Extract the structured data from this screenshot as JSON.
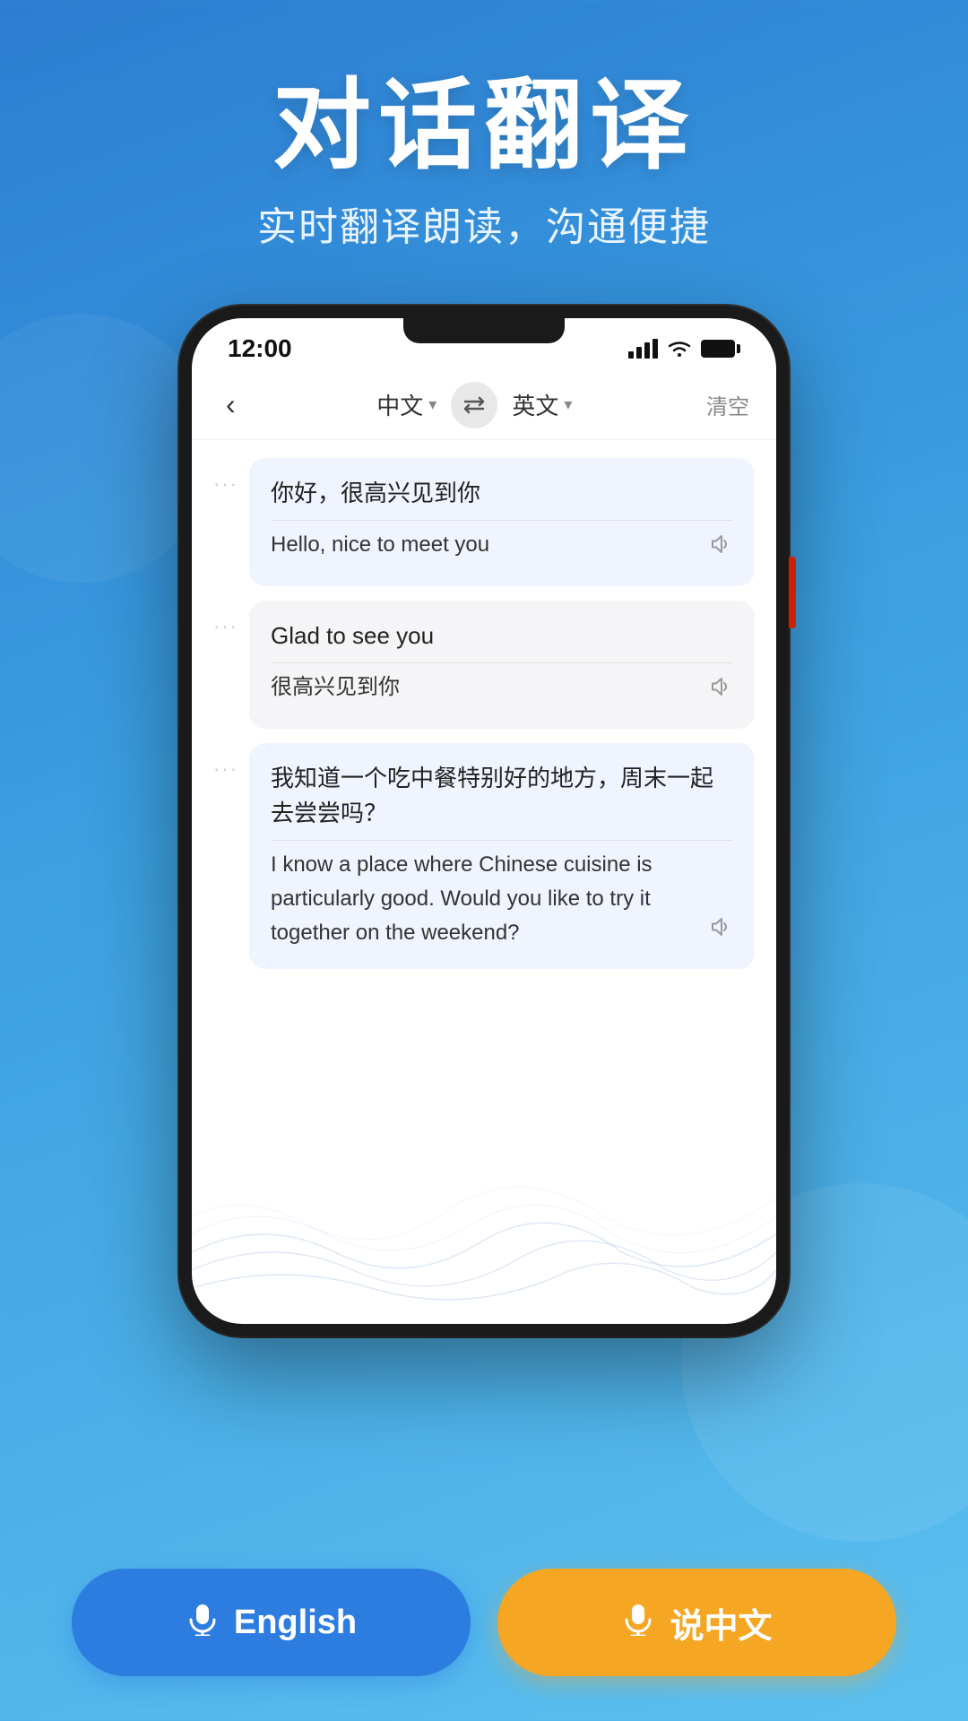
{
  "page": {
    "background_gradient_start": "#2d7dd2",
    "background_gradient_end": "#5bc0f0"
  },
  "header": {
    "main_title": "对话翻译",
    "sub_title": "实时翻译朗读，沟通便捷"
  },
  "phone": {
    "status": {
      "time": "12:00"
    },
    "nav": {
      "back_icon": "‹",
      "lang_left": "中文",
      "lang_right": "英文",
      "swap_icon": "⇄",
      "clear_label": "清空"
    },
    "messages": [
      {
        "id": 1,
        "side": "right",
        "original": "你好，很高兴见到你",
        "translation": "Hello, nice to meet you",
        "dots": "···"
      },
      {
        "id": 2,
        "side": "left",
        "original": "Glad to see you",
        "translation": "很高兴见到你",
        "dots": "···"
      },
      {
        "id": 3,
        "side": "right",
        "original": "我知道一个吃中餐特别好的地方，周末一起去尝尝吗？",
        "translation": "I know a place where Chinese cuisine is particularly good. Would you like to try it together on the weekend?",
        "dots": "···"
      }
    ]
  },
  "buttons": {
    "english": {
      "label": "English",
      "mic_icon": "🎤"
    },
    "chinese": {
      "label": "说中文",
      "mic_icon": "🎤"
    }
  }
}
